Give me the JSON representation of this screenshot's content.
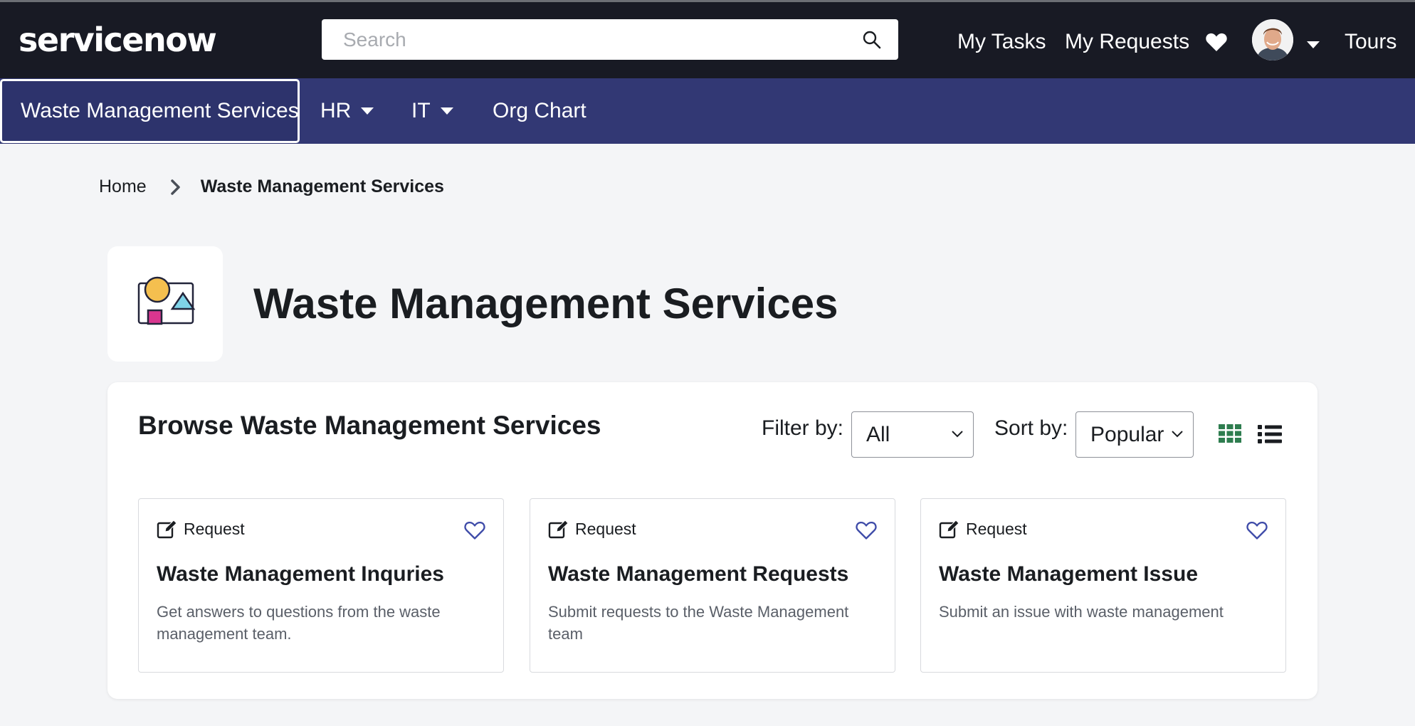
{
  "header": {
    "logo_text": "servicenow",
    "search_placeholder": "Search",
    "links": {
      "my_tasks": "My Tasks",
      "my_requests": "My Requests",
      "tours": "Tours"
    },
    "icons": [
      "search-icon",
      "heart-icon",
      "avatar",
      "chevron-down-icon"
    ]
  },
  "menu": {
    "items": [
      {
        "label": "Waste Management Services",
        "active": true
      },
      {
        "label": "HR",
        "has_dropdown": true
      },
      {
        "label": "IT",
        "has_dropdown": true
      },
      {
        "label": "Org Chart"
      }
    ]
  },
  "breadcrumb": {
    "home": "Home",
    "current": "Waste Management Services"
  },
  "page": {
    "title": "Waste Management Services"
  },
  "browse": {
    "title": "Browse Waste Management Services",
    "filter_label": "Filter by:",
    "filter_value": "All",
    "sort_label": "Sort by:",
    "sort_value": "Popular",
    "cards": [
      {
        "type": "Request",
        "title": "Waste Management Inquries",
        "description": "Get answers to questions from the waste management team."
      },
      {
        "type": "Request",
        "title": "Waste Management Requests",
        "description": "Submit requests to the Waste Management team"
      },
      {
        "type": "Request",
        "title": "Waste Management Issue",
        "description": "Submit an issue with waste management"
      }
    ]
  },
  "colors": {
    "header_bg": "#181a24",
    "menubar_bg": "#323874",
    "page_bg": "#f4f5f7",
    "grid_icon": "#2e7d4f",
    "favorite_icon": "#3d4aa8",
    "logo_accent": "#62d84e"
  }
}
